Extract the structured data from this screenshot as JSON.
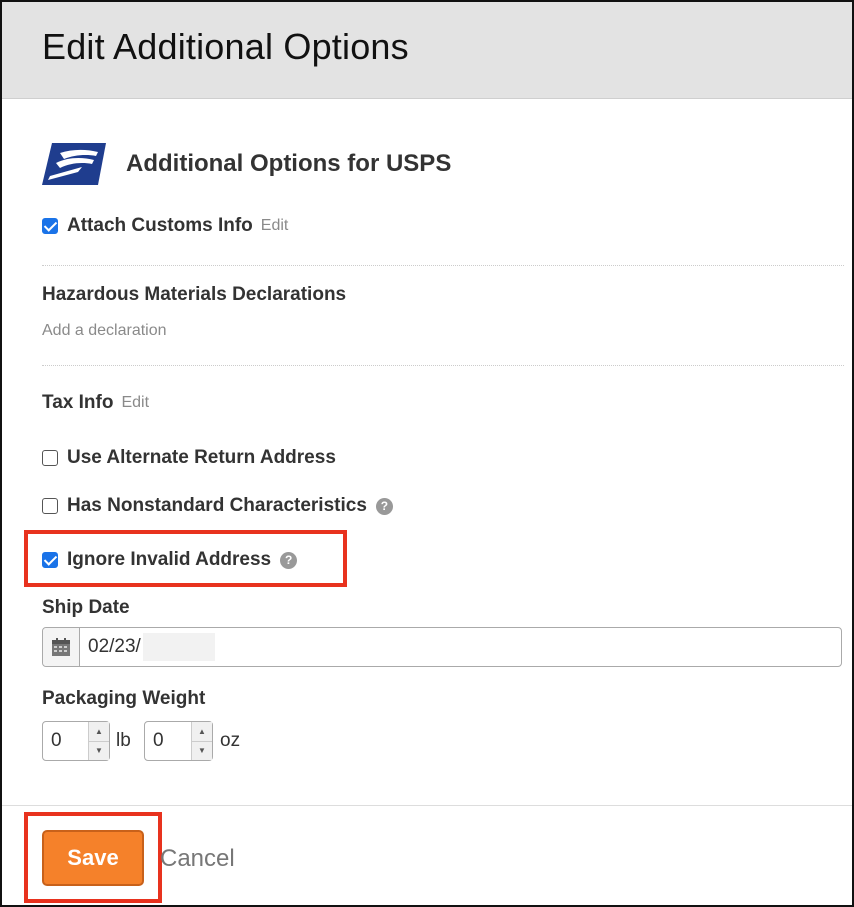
{
  "dialog": {
    "title": "Edit Additional Options"
  },
  "carrier": {
    "logo_icon": "usps-eagle-logo",
    "section_title": "Additional Options for USPS"
  },
  "options": {
    "attach_customs": {
      "label": "Attach Customs Info",
      "checked": true,
      "edit_label": "Edit"
    },
    "hazmat": {
      "title": "Hazardous Materials Declarations",
      "add_label": "Add a declaration"
    },
    "tax_info": {
      "label": "Tax Info",
      "edit_label": "Edit"
    },
    "alternate_return": {
      "label": "Use Alternate Return Address",
      "checked": false
    },
    "nonstandard": {
      "label": "Has Nonstandard Characteristics",
      "checked": false,
      "help_icon": "?"
    },
    "ignore_invalid": {
      "label": "Ignore Invalid Address",
      "checked": true,
      "help_icon": "?"
    }
  },
  "ship_date": {
    "label": "Ship Date",
    "value": "02/23/",
    "icon": "calendar-icon"
  },
  "packaging_weight": {
    "label": "Packaging Weight",
    "lb_value": "0",
    "lb_unit": "lb",
    "oz_value": "0",
    "oz_unit": "oz"
  },
  "footer": {
    "save_label": "Save",
    "cancel_label": "Cancel"
  },
  "colors": {
    "accent_orange": "#f5812a",
    "highlight_red": "#e8321e",
    "checkbox_blue": "#1a73e8",
    "usps_blue": "#1f3d8e"
  }
}
